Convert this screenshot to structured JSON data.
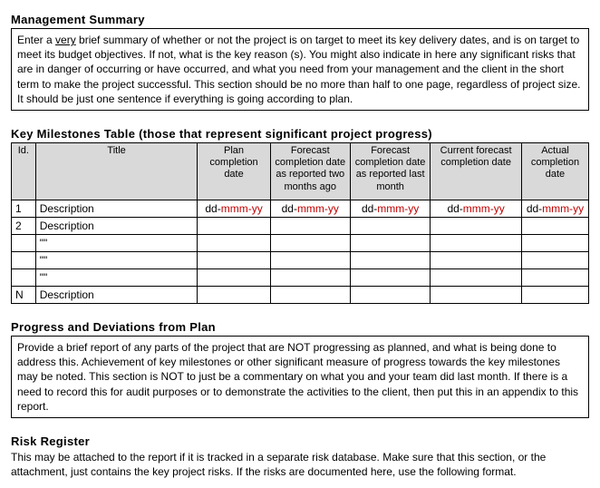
{
  "management_summary": {
    "heading": "Management Summary",
    "body_pre": "Enter a ",
    "body_underlined": "very",
    "body_post": " brief summary of whether or not the project is on target to meet its key delivery dates, and is on target to meet its budget objectives.   If not, what is the key reason (s).  You might also indicate in here any significant risks that are in danger of occurring or have occurred, and what you need from your management and the client in the short term to make the project successful.  This section should be no more than half to one page, regardless of project size.  It should be just one sentence if everything is going according to plan."
  },
  "milestones": {
    "heading": "Key Milestones Table (those that represent significant project progress)",
    "columns": {
      "id": "Id.",
      "title": "Title",
      "plan": "Plan completion date",
      "fc2": "Forecast completion date as reported two months ago",
      "fc1": "Forecast completion date as reported last month",
      "curr": "Current forecast completion date",
      "actual": "Actual completion date"
    },
    "rows": [
      {
        "id": "1",
        "title": "Description",
        "plan_black": "dd-",
        "plan_red": "mmm-yy",
        "fc2_black": "dd-",
        "fc2_red": "mmm-yy",
        "fc1_black": "dd-",
        "fc1_red": "mmm-yy",
        "curr_black": "dd-",
        "curr_red": "mmm-yy",
        "actual_black": "dd-",
        "actual_red": "mmm-yy"
      },
      {
        "id": "2",
        "title": "Description",
        "plan_black": "",
        "plan_red": "",
        "fc2_black": "",
        "fc2_red": "",
        "fc1_black": "",
        "fc1_red": "",
        "curr_black": "",
        "curr_red": "",
        "actual_black": "",
        "actual_red": ""
      },
      {
        "id": "",
        "title": "\"\"",
        "plan_black": "",
        "plan_red": "",
        "fc2_black": "",
        "fc2_red": "",
        "fc1_black": "",
        "fc1_red": "",
        "curr_black": "",
        "curr_red": "",
        "actual_black": "",
        "actual_red": ""
      },
      {
        "id": "",
        "title": "\"\"",
        "plan_black": "",
        "plan_red": "",
        "fc2_black": "",
        "fc2_red": "",
        "fc1_black": "",
        "fc1_red": "",
        "curr_black": "",
        "curr_red": "",
        "actual_black": "",
        "actual_red": ""
      },
      {
        "id": "",
        "title": "\"\"",
        "plan_black": "",
        "plan_red": "",
        "fc2_black": "",
        "fc2_red": "",
        "fc1_black": "",
        "fc1_red": "",
        "curr_black": "",
        "curr_red": "",
        "actual_black": "",
        "actual_red": ""
      },
      {
        "id": "N",
        "title": "Description",
        "plan_black": "",
        "plan_red": "",
        "fc2_black": "",
        "fc2_red": "",
        "fc1_black": "",
        "fc1_red": "",
        "curr_black": "",
        "curr_red": "",
        "actual_black": "",
        "actual_red": ""
      }
    ]
  },
  "progress": {
    "heading": "Progress and Deviations from Plan",
    "body": "Provide a brief report of any parts of the project that are NOT progressing as planned, and what is being done to address this.  Achievement of key milestones or other significant measure of progress towards the key milestones may be noted.  This section is NOT to just be a commentary on what you and your team did last month.  If there is a need to record this for audit purposes or to demonstrate the activities to the client, then put this in an appendix to this report."
  },
  "risk": {
    "heading": "Risk Register",
    "body": "This may be attached to the report if it is tracked in a separate risk database.  Make sure that this section, or the attachment, just contains the key project risks.  If the risks are documented here, use the following format."
  }
}
